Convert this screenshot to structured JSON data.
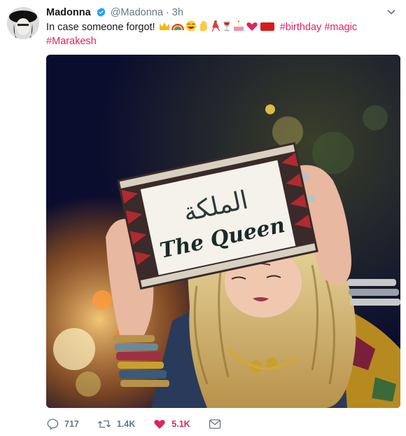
{
  "tweet": {
    "display_name": "Madonna",
    "handle": "@Madonna",
    "separator": "·",
    "time": "3h",
    "text": "In case someone forgot!",
    "hashtags_line1": "#birthday #magic",
    "hashtags_line2": "#Marakesh",
    "image_sign_arabic": "الملكة",
    "image_sign_english": "The Queen"
  },
  "actions": {
    "replies": "717",
    "retweets": "1.4K",
    "likes": "5.1K"
  },
  "colors": {
    "hashtag": "#e0245e",
    "verified": "#1da1f2",
    "meta_gray": "#657786"
  },
  "icons": [
    "verified-badge-icon",
    "chevron-down-icon",
    "reply-icon",
    "retweet-icon",
    "heart-icon",
    "direct-message-icon"
  ]
}
